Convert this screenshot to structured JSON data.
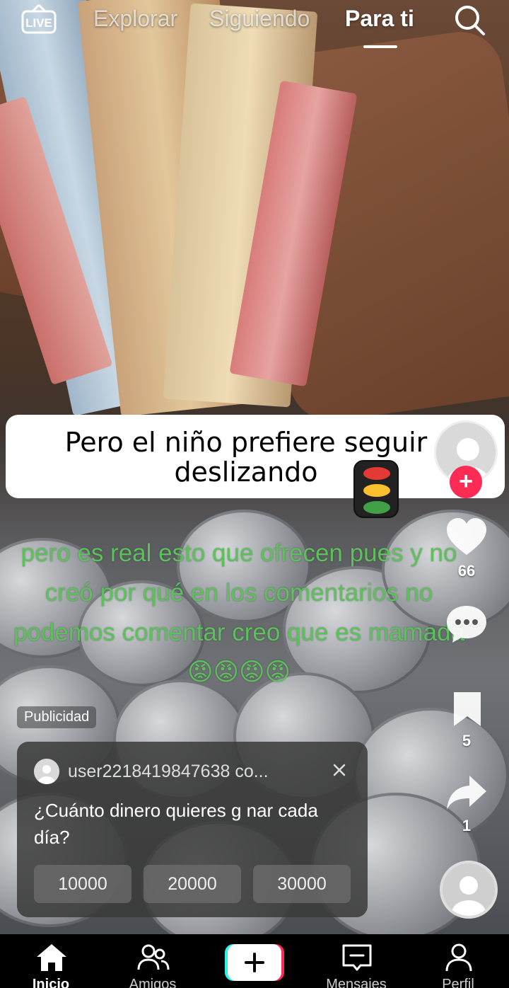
{
  "top_bar": {
    "live_label": "LIVE",
    "tabs": [
      {
        "label": "Explorar"
      },
      {
        "label": "Siguiendo"
      },
      {
        "label": "Para ti"
      }
    ],
    "active_tab": "Para ti",
    "search_icon": "search-icon"
  },
  "video": {
    "banner_text": "Pero el niño prefiere seguir deslizando",
    "overlay_text": "pero es real esto que ofrecen pues y no creó por qué en los  comentarios no podemos comentar creo que es mamada😡😡😡😡"
  },
  "actions": {
    "likes": "66",
    "bookmarks": "5",
    "shares": "1"
  },
  "ad": {
    "label": "Publicidad",
    "user": "user2218419847638 co...",
    "question": "¿Cuánto dinero quieres g nar cada día?",
    "options": [
      "10000",
      "20000",
      "30000"
    ]
  },
  "bottom_nav": {
    "items": [
      {
        "label": "Inicio",
        "icon": "home-icon"
      },
      {
        "label": "Amigos",
        "icon": "friends-icon"
      },
      {
        "label": "",
        "icon": "create-icon"
      },
      {
        "label": "Mensajes",
        "icon": "inbox-icon"
      },
      {
        "label": "Perfil",
        "icon": "profile-icon"
      }
    ]
  },
  "colors": {
    "accent_pink": "#fe2c55",
    "accent_cyan": "#25f4ee",
    "overlay_green": "#5cc15a"
  }
}
